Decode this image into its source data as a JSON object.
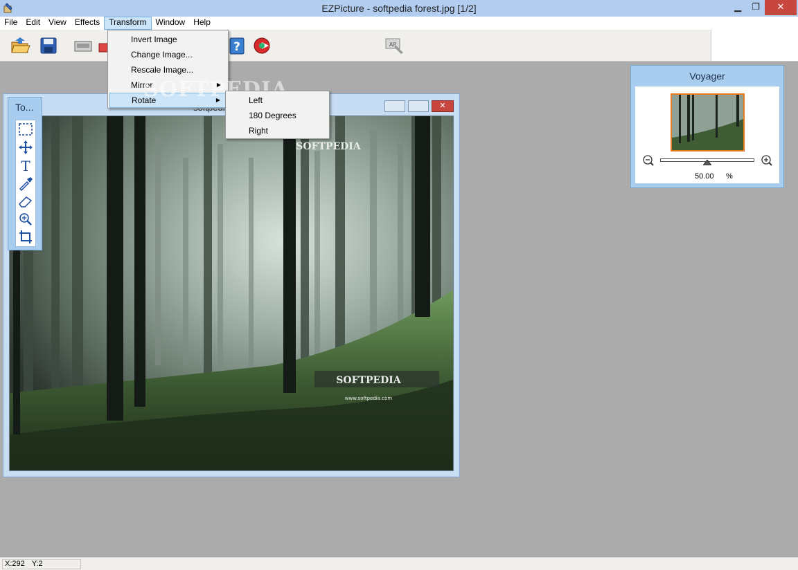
{
  "window": {
    "title": "EZPicture - softpedia forest.jpg [1/2]",
    "minimize_glyph": "▁",
    "maximize_glyph": "❐",
    "close_glyph": "✕"
  },
  "menubar": {
    "items": [
      "File",
      "Edit",
      "View",
      "Effects",
      "Transform",
      "Window",
      "Help"
    ],
    "active": "Transform"
  },
  "transform_menu": {
    "items": [
      {
        "label": "Invert Image",
        "has_submenu": false
      },
      {
        "label": "Change Image...",
        "has_submenu": false
      },
      {
        "label": "Rescale Image...",
        "has_submenu": false
      },
      {
        "label": "Mirror",
        "has_submenu": true
      },
      {
        "label": "Rotate",
        "has_submenu": true
      }
    ],
    "highlighted": "Rotate",
    "submenu_arrow": "▶"
  },
  "rotate_submenu": {
    "items": [
      "Left",
      "180 Degrees",
      "Right"
    ]
  },
  "toolbar": {
    "icons": [
      "open-icon",
      "save-icon",
      "scanner-icon",
      "print-icon",
      "help-icon",
      "exit-icon",
      "acquire-icon"
    ]
  },
  "image_window": {
    "title": "softpedia forest.jpg",
    "photo_text_top": "SOFTPEDIA",
    "photo_text_bottom": "SOFTPEDIA",
    "photo_url": "www.softpedia.com",
    "close_glyph": "✕"
  },
  "watermark": "SOFTPEDIA",
  "tool_palette": {
    "title": "To...",
    "tools": [
      "selection-icon",
      "move-icon",
      "text-icon",
      "eyedropper-icon",
      "eraser-icon",
      "zoom-icon",
      "crop-icon"
    ]
  },
  "voyager": {
    "title": "Voyager",
    "zoom_value": "50.00",
    "zoom_unit": "%",
    "zoom_fraction": 0.5
  },
  "statusbar": {
    "x": "X:292",
    "y": "Y:2"
  },
  "colors": {
    "titlebar": "#b3cdf0",
    "workspace": "#ababab",
    "panel_blue": "#a8cdee",
    "menu_highlight": "#cce4f7",
    "close_red": "#c7473e",
    "thumb_border": "#e67a1f"
  }
}
